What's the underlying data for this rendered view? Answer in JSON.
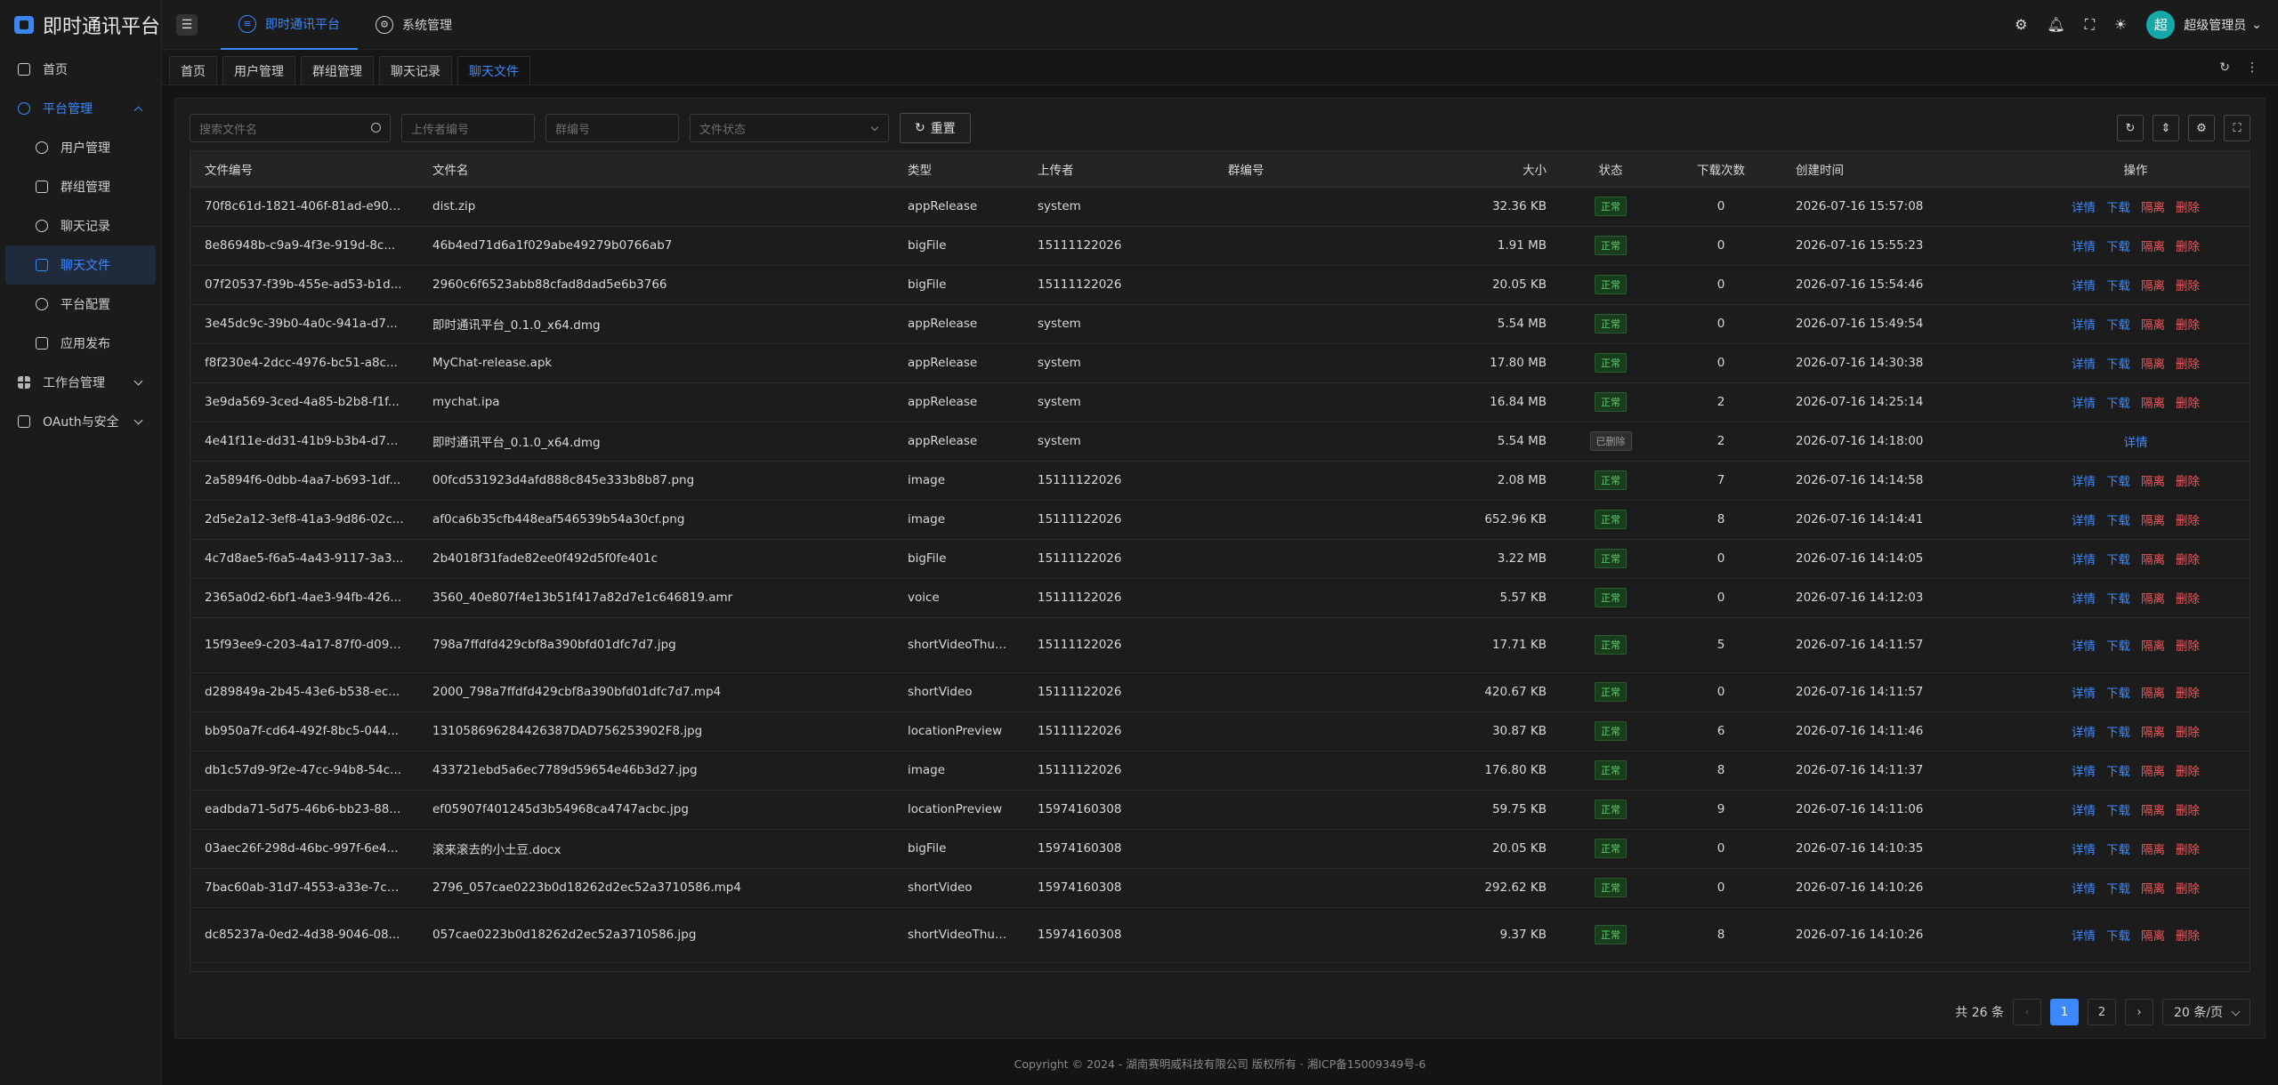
{
  "app": {
    "title": "即时通讯平台"
  },
  "sidebar": {
    "items": [
      {
        "label": "首页",
        "icon": "monitor-icon"
      },
      {
        "label": "平台管理",
        "icon": "gear-icon"
      },
      {
        "label": "用户管理",
        "icon": "user-icon"
      },
      {
        "label": "群组管理",
        "icon": "group-icon"
      },
      {
        "label": "聊天记录",
        "icon": "chat-icon"
      },
      {
        "label": "聊天文件",
        "icon": "file-icon"
      },
      {
        "label": "平台配置",
        "icon": "settings-icon"
      },
      {
        "label": "应用发布",
        "icon": "publish-icon"
      },
      {
        "label": "工作台管理",
        "icon": "grid-icon"
      },
      {
        "label": "OAuth与安全",
        "icon": "lock-icon"
      }
    ]
  },
  "topbar": {
    "tabs": [
      {
        "label": "即时通讯平台"
      },
      {
        "label": "系统管理"
      }
    ],
    "avatar_text": "超",
    "username": "超级管理员"
  },
  "page_tabs": [
    {
      "label": "首页"
    },
    {
      "label": "用户管理"
    },
    {
      "label": "群组管理"
    },
    {
      "label": "聊天记录"
    },
    {
      "label": "聊天文件"
    }
  ],
  "filters": {
    "search_placeholder": "搜索文件名",
    "uploader_placeholder": "上传者编号",
    "group_placeholder": "群编号",
    "status_placeholder": "文件状态",
    "reset_label": "重置"
  },
  "table": {
    "columns": [
      "文件编号",
      "文件名",
      "类型",
      "上传者",
      "群编号",
      "大小",
      "状态",
      "下载次数",
      "创建时间",
      "操作"
    ],
    "actions": {
      "detail": "详情",
      "download": "下载",
      "isolate": "隔离",
      "delete": "删除"
    },
    "rows": [
      {
        "id": "70f8c61d-1821-406f-81ad-e900...",
        "name": "dist.zip",
        "type": "appRelease",
        "uploader": "system",
        "group": "",
        "size": "32.36 KB",
        "status": "正常",
        "downloads": "0",
        "created": "2026-07-16 15:57:08"
      },
      {
        "id": "8e86948b-c9a9-4f3e-919d-8c...",
        "name": "46b4ed71d6a1f029abe49279b0766ab7",
        "type": "bigFile",
        "uploader": "15111122026",
        "group": "",
        "size": "1.91 MB",
        "status": "正常",
        "downloads": "0",
        "created": "2026-07-16 15:55:23"
      },
      {
        "id": "07f20537-f39b-455e-ad53-b1d...",
        "name": "2960c6f6523abb88cfad8dad5e6b3766",
        "type": "bigFile",
        "uploader": "15111122026",
        "group": "",
        "size": "20.05 KB",
        "status": "正常",
        "downloads": "0",
        "created": "2026-07-16 15:54:46"
      },
      {
        "id": "3e45dc9c-39b0-4a0c-941a-d7...",
        "name": "即时通讯平台_0.1.0_x64.dmg",
        "type": "appRelease",
        "uploader": "system",
        "group": "",
        "size": "5.54 MB",
        "status": "正常",
        "downloads": "0",
        "created": "2026-07-16 15:49:54"
      },
      {
        "id": "f8f230e4-2dcc-4976-bc51-a8c...",
        "name": "MyChat-release.apk",
        "type": "appRelease",
        "uploader": "system",
        "group": "",
        "size": "17.80 MB",
        "status": "正常",
        "downloads": "0",
        "created": "2026-07-16 14:30:38"
      },
      {
        "id": "3e9da569-3ced-4a85-b2b8-f1f...",
        "name": "mychat.ipa",
        "type": "appRelease",
        "uploader": "system",
        "group": "",
        "size": "16.84 MB",
        "status": "正常",
        "downloads": "2",
        "created": "2026-07-16 14:25:14"
      },
      {
        "id": "4e41f11e-dd31-41b9-b3b4-d7cc...",
        "name": "即时通讯平台_0.1.0_x64.dmg",
        "type": "appRelease",
        "uploader": "system",
        "group": "",
        "size": "5.54 MB",
        "status": "已删除",
        "downloads": "2",
        "created": "2026-07-16 14:18:00"
      },
      {
        "id": "2a5894f6-0dbb-4aa7-b693-1df...",
        "name": "00fcd531923d4afd888c845e333b8b87.png",
        "type": "image",
        "uploader": "15111122026",
        "group": "",
        "size": "2.08 MB",
        "status": "正常",
        "downloads": "7",
        "created": "2026-07-16 14:14:58"
      },
      {
        "id": "2d5e2a12-3ef8-41a3-9d86-02c...",
        "name": "af0ca6b35cfb448eaf546539b54a30cf.png",
        "type": "image",
        "uploader": "15111122026",
        "group": "",
        "size": "652.96 KB",
        "status": "正常",
        "downloads": "8",
        "created": "2026-07-16 14:14:41"
      },
      {
        "id": "4c7d8ae5-f6a5-4a43-9117-3a3...",
        "name": "2b4018f31fade82ee0f492d5f0fe401c",
        "type": "bigFile",
        "uploader": "15111122026",
        "group": "",
        "size": "3.22 MB",
        "status": "正常",
        "downloads": "0",
        "created": "2026-07-16 14:14:05"
      },
      {
        "id": "2365a0d2-6bf1-4ae3-94fb-426...",
        "name": "3560_40e807f4e13b51f417a82d7e1c646819.amr",
        "type": "voice",
        "uploader": "15111122026",
        "group": "",
        "size": "5.57 KB",
        "status": "正常",
        "downloads": "0",
        "created": "2026-07-16 14:12:03"
      },
      {
        "id": "15f93ee9-c203-4a17-87f0-d091...",
        "name": "798a7ffdfd429cbf8a390bfd01dfc7d7.jpg",
        "type": "shortVideoThumbnail",
        "uploader": "15111122026",
        "group": "",
        "size": "17.71 KB",
        "status": "正常",
        "downloads": "5",
        "created": "2026-07-16 14:11:57"
      },
      {
        "id": "d289849a-2b45-43e6-b538-ec...",
        "name": "2000_798a7ffdfd429cbf8a390bfd01dfc7d7.mp4",
        "type": "shortVideo",
        "uploader": "15111122026",
        "group": "",
        "size": "420.67 KB",
        "status": "正常",
        "downloads": "0",
        "created": "2026-07-16 14:11:57"
      },
      {
        "id": "bb950a7f-cd64-492f-8bc5-044...",
        "name": "131058696284426387DAD756253902F8.jpg",
        "type": "locationPreview",
        "uploader": "15111122026",
        "group": "",
        "size": "30.87 KB",
        "status": "正常",
        "downloads": "6",
        "created": "2026-07-16 14:11:46"
      },
      {
        "id": "db1c57d9-9f2e-47cc-94b8-54c...",
        "name": "433721ebd5a6ec7789d59654e46b3d27.jpg",
        "type": "image",
        "uploader": "15111122026",
        "group": "",
        "size": "176.80 KB",
        "status": "正常",
        "downloads": "8",
        "created": "2026-07-16 14:11:37"
      },
      {
        "id": "eadbda71-5d75-46b6-bb23-88...",
        "name": "ef05907f401245d3b54968ca4747acbc.jpg",
        "type": "locationPreview",
        "uploader": "15974160308",
        "group": "",
        "size": "59.75 KB",
        "status": "正常",
        "downloads": "9",
        "created": "2026-07-16 14:11:06"
      },
      {
        "id": "03aec26f-298d-46bc-997f-6e4...",
        "name": "滚来滚去的小土豆.docx",
        "type": "bigFile",
        "uploader": "15974160308",
        "group": "",
        "size": "20.05 KB",
        "status": "正常",
        "downloads": "0",
        "created": "2026-07-16 14:10:35"
      },
      {
        "id": "7bac60ab-31d7-4553-a33e-7cd...",
        "name": "2796_057cae0223b0d18262d2ec52a3710586.mp4",
        "type": "shortVideo",
        "uploader": "15974160308",
        "group": "",
        "size": "292.62 KB",
        "status": "正常",
        "downloads": "0",
        "created": "2026-07-16 14:10:26"
      },
      {
        "id": "dc85237a-0ed2-4d38-9046-08...",
        "name": "057cae0223b0d18262d2ec52a3710586.jpg",
        "type": "shortVideoThumbnail",
        "uploader": "15974160308",
        "group": "",
        "size": "9.37 KB",
        "status": "正常",
        "downloads": "8",
        "created": "2026-07-16 14:10:26"
      }
    ]
  },
  "pagination": {
    "total_text": "共 26 条",
    "pages": [
      "1",
      "2"
    ],
    "page_size": "20 条/页"
  },
  "footer": {
    "text": "Copyright © 2024 - 湖南赛明威科技有限公司 版权所有 · 湘ICP备15009349号-6"
  },
  "colors": {
    "accent": "#3c89ff",
    "danger": "#f0585d",
    "success": "#5fd16b",
    "avatar": "#14a8a8"
  }
}
